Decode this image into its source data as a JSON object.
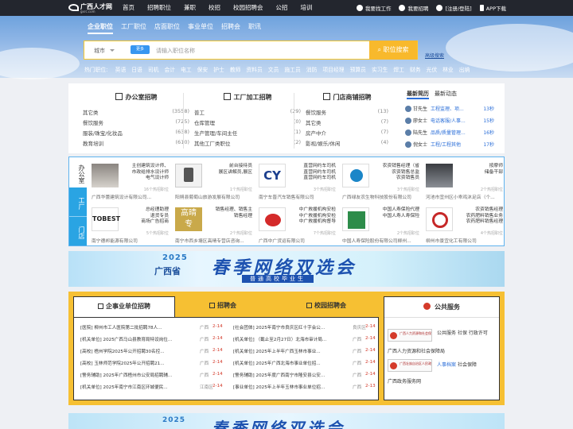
{
  "logo": {
    "name": "广西人才网",
    "domain": "gxrc.com"
  },
  "nav": [
    "首页",
    "招聘职位",
    "兼职",
    "校招",
    "校园招聘会",
    "公招",
    "培训"
  ],
  "topright": [
    "我要找工作",
    "我要招聘",
    "[注册/登陆]",
    "APP下载"
  ],
  "search": {
    "tabs": [
      "企业职位",
      "工厂职位",
      "店面职位",
      "事业单位",
      "招聘会",
      "职讯"
    ],
    "city": "城市",
    "tag": "更多",
    "placeholder": "请输入职位名称",
    "button": "职位搜索",
    "advanced": "高级搜索"
  },
  "hot": {
    "label": "热门职位:",
    "items": [
      "英语",
      "日语",
      "司机",
      "会计",
      "电工",
      "保安",
      "护士",
      "教师",
      "资料员",
      "文员",
      "施工员",
      "消防",
      "项目经理",
      "预算员",
      "实习生",
      "焊工",
      "财务",
      "光伏",
      "林业",
      "出纳"
    ]
  },
  "categories": [
    {
      "title": "办公室招聘",
      "rows": [
        [
          "其它类",
          "(3558)"
        ],
        [
          "餐饮服务",
          "(725)"
        ],
        [
          "服装/珠宝/化妆品",
          "(638)"
        ],
        [
          "教育培训",
          "(610)"
        ]
      ]
    },
    {
      "title": "工厂加工招聘",
      "rows": [
        [
          "普工",
          "(29)"
        ],
        [
          "仓库管理",
          "(0)"
        ],
        [
          "生产管理/车间主任",
          "(1)"
        ],
        [
          "其他工厂类职位",
          "(2)"
        ]
      ]
    },
    {
      "title": "门店商铺招聘",
      "rows": [
        [
          "餐饮服务",
          "(13)"
        ],
        [
          "其它类",
          "(7)"
        ],
        [
          "房产中介",
          "(7)"
        ],
        [
          "影视/娱乐/休闲",
          "(4)"
        ]
      ]
    }
  ],
  "latest": {
    "tabs": [
      "最新简历",
      "最新动态"
    ],
    "rows": [
      {
        "name": "甘先生",
        "job": "工程监理、项...",
        "ago": "13秒"
      },
      {
        "name": "廖女士",
        "job": "电话客服/人事...",
        "ago": "15秒"
      },
      {
        "name": "陆先生",
        "job": "品质/质量管理...",
        "ago": "16秒"
      },
      {
        "name": "倪女士",
        "job": "工程/工程其他",
        "ago": "17秒"
      }
    ]
  },
  "vtabs": [
    "办公室",
    "工厂",
    "门店"
  ],
  "companies": [
    {
      "jobs": [
        "主创建筑设计师、",
        "市政给排水设计师",
        "电气设计师"
      ],
      "more": "16个热招职位",
      "name": "广西华蕾建筑设计有限公司..."
    },
    {
      "jobs": [
        "前台接待员",
        "展区讲解员,展区"
      ],
      "more": "1个热招职位",
      "name": "阳朔县葡萄山旅游发展有限公司"
    },
    {
      "jobs": [
        "直营网约车司机",
        "直营网约车司机",
        "直营网约车司机"
      ],
      "more": "3个热招职位",
      "name": "南宁车晋汽车销售有限公司"
    },
    {
      "jobs": [
        "农资销售经理（省",
        "农资销售总监",
        "农资销售员"
      ],
      "more": "3个热招职位",
      "name": "广西绿友农生物科技股份有限公司"
    },
    {
      "jobs": [
        "按摩师",
        "储备干部"
      ],
      "more": "2个热招职位",
      "name": "河池市宜州区小乖鸡沐足店（个..."
    },
    {
      "jobs": [
        "总经理助理",
        "退货专员",
        "商场广告招商"
      ],
      "more": "5个热招职位",
      "name": "南宁德邦能源有限公司"
    },
    {
      "jobs": [
        "销售经理、销售主",
        "销售经理"
      ],
      "more": "2个热招职位",
      "name": "南宁市西乡塘区高晴专营店咨询..."
    },
    {
      "jobs": [
        "中广救援机构安检",
        "中广救援机构安检",
        "中广救援机构督导"
      ],
      "more": "7个热招职位",
      "name": "广西中广货运有限公司"
    },
    {
      "jobs": [
        "中国人寿保险代理",
        "中国人寿人寿保险"
      ],
      "more": "2个热招职位",
      "name": "中国人寿保险股份有限公司柳州..."
    },
    {
      "jobs": [
        "农资销售经理",
        "农药肥料销售业务",
        "农药肥料销售经理"
      ],
      "more": "4个热招职位",
      "name": "柳州市景宜化工有限公司"
    }
  ],
  "banner": {
    "year": "2025",
    "province": "广西省",
    "main": "春季网络双选会",
    "sub": "普通高校毕业生"
  },
  "panel": {
    "tabs": [
      "企事业单位招聘",
      "招聘会",
      "校园招聘会"
    ],
    "left": [
      {
        "t": "[医院] 柳州市工人医院第二批招聘78人...",
        "a": "广西",
        "d": "2-14"
      },
      {
        "t": "[机关单位] 2025广西马山县教育局特设岗位...",
        "a": "广西",
        "d": "2-14"
      },
      {
        "t": "[高校] 梧州学院2025年公开招聘30名控...",
        "a": "广西",
        "d": "2-14"
      },
      {
        "t": "[高校] 玉林师范学院2025年公开招聘21...",
        "a": "广西",
        "d": "2-14"
      },
      {
        "t": "[警务辅助] 2025年广西梧州市公安局招聘辅...",
        "a": "广西",
        "d": "2-14"
      },
      {
        "t": "[机关单位] 2025年南宁市江南区环城便民...",
        "a": "江南区",
        "d": "2-14"
      }
    ],
    "right": [
      {
        "t": "[社会团体] 2025年南宁市良庆区红十字会公...",
        "a": "良庆区",
        "d": "2-14"
      },
      {
        "t": "[机关单位] （截止至2月27日）北海市审计局...",
        "a": "广西",
        "d": "2-14"
      },
      {
        "t": "[机关单位] 2025年上半年广西玉林市事业...",
        "a": "广西",
        "d": "2-14"
      },
      {
        "t": "[机关单位] 2025年广西北海市事业单位招...",
        "a": "广西",
        "d": "2-14"
      },
      {
        "t": "[警务辅助] 2025年度广西南宁市隆安县公安...",
        "a": "广西",
        "d": "2-14"
      },
      {
        "t": "[事业单位] 2025年上半年玉林市事业单位招...",
        "a": "广西",
        "d": "2-13"
      }
    ],
    "public": {
      "title": "公共服务",
      "emb1": "广西人力资源和社会保障厅",
      "emb2": "广西壮族自治区人民政府",
      "links1": [
        "公共服务",
        "社保",
        "行政许可"
      ],
      "name1": "广西人力资源和社会保障局",
      "links2": [
        "人事档案",
        "社会保障"
      ],
      "name2": "广西政务服务网"
    }
  },
  "banner2": {
    "year": "2025",
    "main": "春季网络双选会"
  }
}
